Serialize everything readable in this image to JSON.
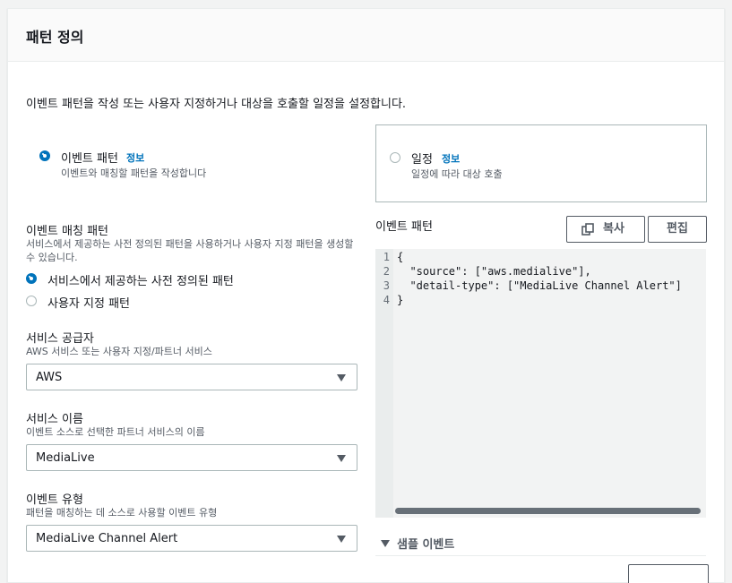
{
  "panel": {
    "title": "패턴 정의",
    "description": "이벤트 패턴을 작성 또는 사용자 지정하거나 대상을 호출할 일정을 설정합니다."
  },
  "rule_type": {
    "event_pattern": {
      "label": "이벤트 패턴",
      "info": "정보",
      "sub": "이벤트와 매칭할 패턴을 작성합니다",
      "selected": true
    },
    "schedule": {
      "label": "일정",
      "info": "정보",
      "sub": "일정에 따라 대상 호출",
      "selected": false
    }
  },
  "matching": {
    "label": "이벤트 매칭 패턴",
    "desc": "서비스에서 제공하는 사전 정의된 패턴을 사용하거나 사용자 지정 패턴을 생성할 수 있습니다.",
    "options": [
      {
        "label": "서비스에서 제공하는 사전 정의된 패턴",
        "selected": true
      },
      {
        "label": "사용자 지정 패턴",
        "selected": false
      }
    ]
  },
  "service_provider": {
    "label": "서비스 공급자",
    "desc": "AWS 서비스 또는 사용자 지정/파트너 서비스",
    "value": "AWS"
  },
  "service_name": {
    "label": "서비스 이름",
    "desc": "이벤트 소스로 선택한 파트너 서비스의 이름",
    "value": "MediaLive"
  },
  "event_type": {
    "label": "이벤트 유형",
    "desc": "패턴을 매칭하는 데 소스로 사용할 이벤트 유형",
    "value": "MediaLive Channel Alert"
  },
  "pattern_editor": {
    "label": "이벤트 패턴",
    "copy_label": "복사",
    "edit_label": "편집",
    "lines": [
      {
        "no": "1",
        "text": "{"
      },
      {
        "no": "2",
        "text": "  \"source\": [\"aws.medialive\"],"
      },
      {
        "no": "3",
        "text": "  \"detail-type\": [\"MediaLive Channel Alert\"]"
      },
      {
        "no": "4",
        "text": "}"
      }
    ]
  },
  "sample_events": {
    "label": "샘플 이벤트"
  },
  "colors": {
    "accent": "#0073bb",
    "text": "#16191f",
    "secondary": "#545b64",
    "border": "#aab7b8"
  },
  "icons": {
    "copy": "copy-icon",
    "expand": "caret-down-icon"
  }
}
